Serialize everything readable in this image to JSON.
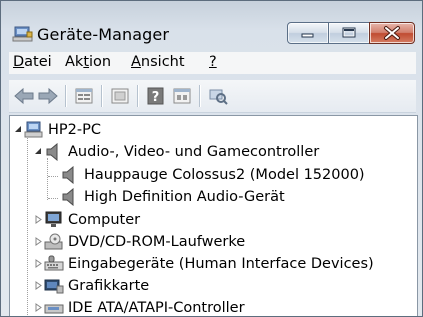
{
  "window": {
    "title": "Geräte-Manager",
    "icon": "device-manager-icon"
  },
  "caption_buttons": [
    "minimize-icon",
    "maximize-icon",
    "close-icon"
  ],
  "menubar": {
    "items": [
      {
        "label_pre": "",
        "mnemonic": "D",
        "label_post": "atei"
      },
      {
        "label_pre": "Ak",
        "mnemonic": "t",
        "label_post": "ion"
      },
      {
        "label_pre": "",
        "mnemonic": "A",
        "label_post": "nsicht"
      },
      {
        "label_pre": "",
        "mnemonic": "?",
        "label_post": ""
      }
    ]
  },
  "toolbar": {
    "buttons": [
      "back-arrow-icon",
      "forward-arrow-icon",
      "properties-icon",
      "show-hide-icon",
      "help-icon",
      "view-icon",
      "scan-hardware-icon"
    ]
  },
  "tree": {
    "root": {
      "label": "HP2-PC",
      "icon": "computer-icon",
      "expanded": true
    },
    "nodes": [
      {
        "label": "Audio-, Video- und Gamecontroller",
        "icon": "speaker-icon",
        "expanded": true,
        "level": 1
      },
      {
        "label": "Hauppauge Colossus2 (Model 152000)",
        "icon": "speaker-icon",
        "level": 2
      },
      {
        "label": "High Definition Audio-Gerät",
        "icon": "speaker-icon",
        "level": 2
      },
      {
        "label": "Computer",
        "icon": "monitor-icon",
        "expanded": false,
        "level": 1
      },
      {
        "label": "DVD/CD-ROM-Laufwerke",
        "icon": "dvd-drive-icon",
        "expanded": false,
        "level": 1
      },
      {
        "label": "Eingabegeräte (Human Interface Devices)",
        "icon": "keyboard-icon",
        "expanded": false,
        "level": 1
      },
      {
        "label": "Grafikkarte",
        "icon": "graphics-card-icon",
        "expanded": false,
        "level": 1
      },
      {
        "label": "IDE ATA/ATAPI-Controller",
        "icon": "ide-controller-icon",
        "expanded": false,
        "level": 1
      }
    ]
  }
}
